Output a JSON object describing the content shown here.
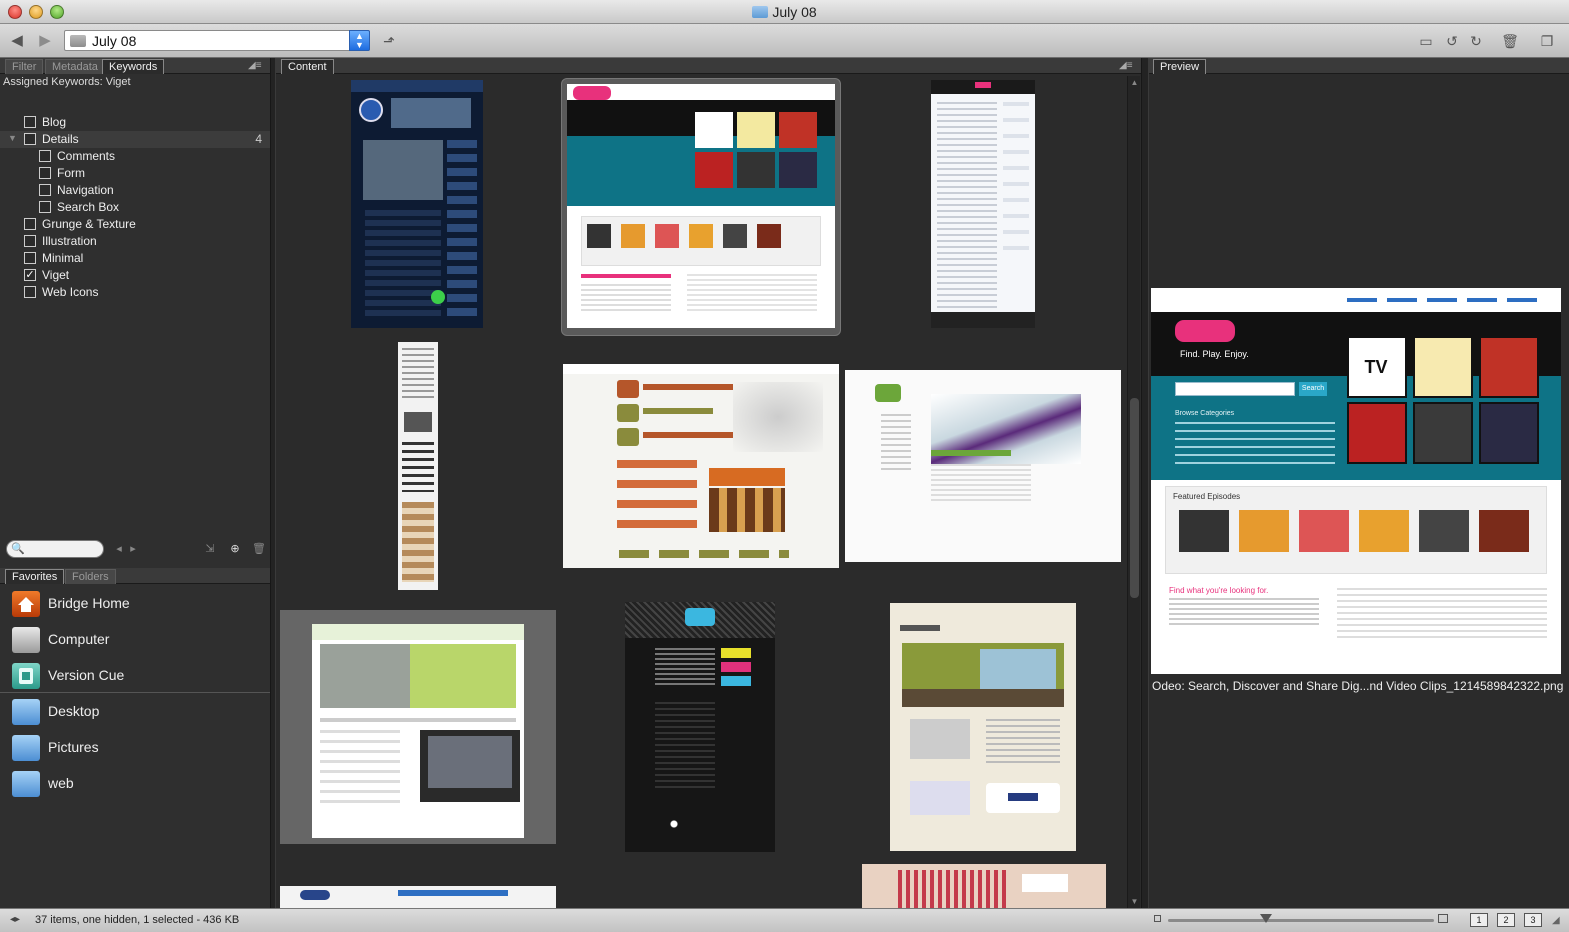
{
  "window": {
    "title": "July 08"
  },
  "toolbar": {
    "path": "July 08"
  },
  "left_panel": {
    "tabs": [
      "Filter",
      "Metadata",
      "Keywords"
    ],
    "active_tab": "Keywords",
    "assigned_keywords": "Assigned Keywords: Viget",
    "keywords": [
      {
        "label": "Blog",
        "checked": false,
        "indent": 0
      },
      {
        "label": "Details",
        "checked": false,
        "indent": 0,
        "count": "4",
        "expanded": true
      },
      {
        "label": "Comments",
        "checked": false,
        "indent": 1
      },
      {
        "label": "Form",
        "checked": false,
        "indent": 1
      },
      {
        "label": "Navigation",
        "checked": false,
        "indent": 1
      },
      {
        "label": "Search Box",
        "checked": false,
        "indent": 1
      },
      {
        "label": "Grunge & Texture",
        "checked": false,
        "indent": 0
      },
      {
        "label": "Illustration",
        "checked": false,
        "indent": 0
      },
      {
        "label": "Minimal",
        "checked": false,
        "indent": 0
      },
      {
        "label": "Viget",
        "checked": true,
        "indent": 0
      },
      {
        "label": "Web Icons",
        "checked": false,
        "indent": 0
      }
    ],
    "bottom_tabs": [
      "Favorites",
      "Folders"
    ],
    "active_bottom_tab": "Favorites",
    "favorites": [
      {
        "label": "Bridge Home",
        "icon": "bridge-home-icon"
      },
      {
        "label": "Computer",
        "icon": "computer-icon"
      },
      {
        "label": "Version Cue",
        "icon": "version-cue-icon"
      },
      {
        "label": "Desktop",
        "icon": "folder-icon"
      },
      {
        "label": "Pictures",
        "icon": "folder-icon"
      },
      {
        "label": "web",
        "icon": "folder-icon"
      }
    ]
  },
  "content": {
    "tab": "Content"
  },
  "preview": {
    "tab": "Preview",
    "caption": "Odeo: Search, Discover and Share Dig...nd Video Clips_1214589842322.png",
    "thumb_texts": {
      "tagline": "Find. Play. Enjoy.",
      "search_button": "Search",
      "browse": "Browse Categories",
      "featured": "Featured Episodes",
      "find_text": "Find what you're looking for."
    }
  },
  "status": {
    "text": "37 items, one hidden, 1 selected - 436 KB",
    "view_buttons": [
      "1",
      "2",
      "3"
    ]
  },
  "colors": {
    "panel_bg": "#2b2b2b",
    "odeo_teal": "#0e7386",
    "odeo_pink": "#e8317c"
  }
}
